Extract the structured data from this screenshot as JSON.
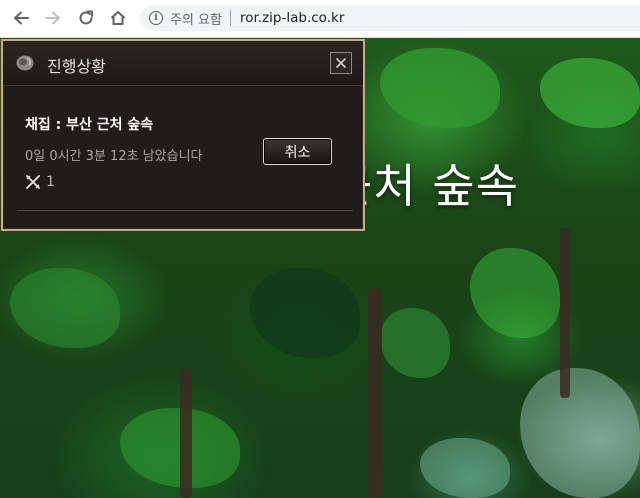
{
  "browser": {
    "security_label": "주의 요함",
    "url": "ror.zip-lab.co.kr",
    "info_icon": "i"
  },
  "scene": {
    "title": "근처 숲속"
  },
  "dialog": {
    "title": "진행상황",
    "task": "채집 : 부산 근처 숲속",
    "time_remaining": "0일 0시간 3분 12초 남았습니다",
    "cancel_label": "취소",
    "count": "1"
  },
  "colors": {
    "dialog_border": "#c9a98a",
    "dialog_bg": "#1f1c1a",
    "text_primary": "#ffffff",
    "text_secondary": "#a7a7a7"
  }
}
